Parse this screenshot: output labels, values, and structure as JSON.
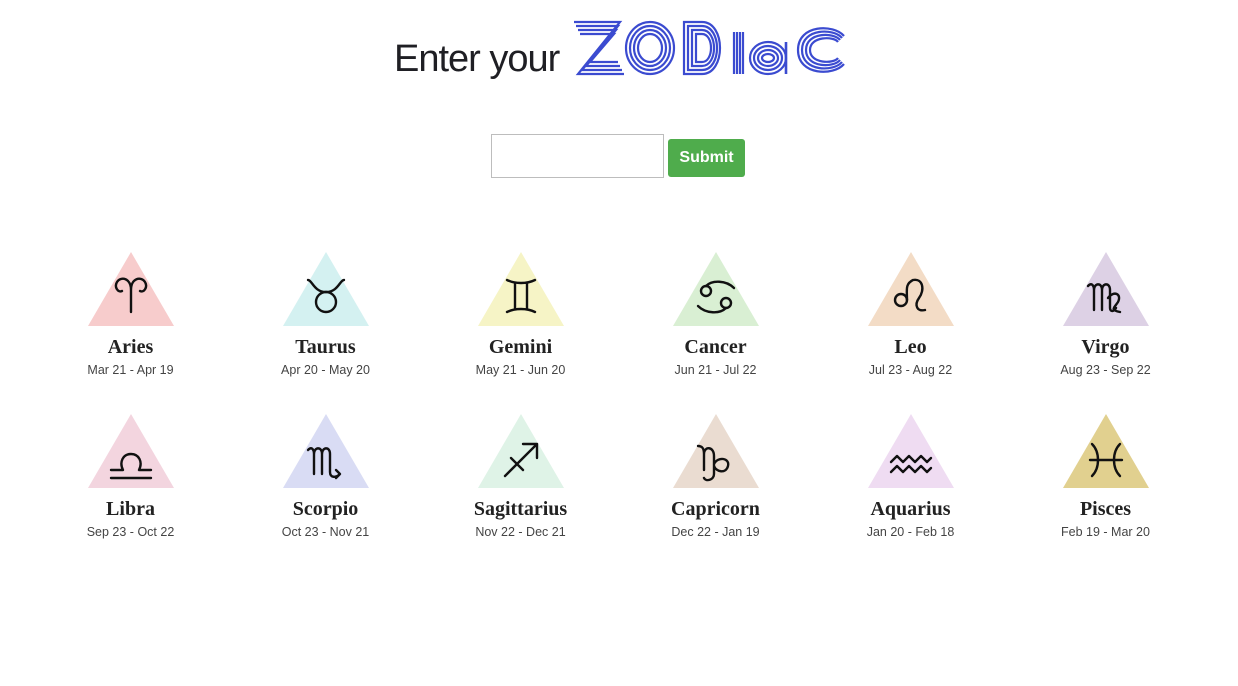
{
  "header": {
    "prefix": "Enter your",
    "logo_text": "ZODIAC",
    "logo_color": "#3b4bd0"
  },
  "search": {
    "input_value": "",
    "placeholder": "",
    "submit_label": "Submit",
    "submit_color": "#4fac4c"
  },
  "signs": [
    {
      "name": "Aries",
      "dates": "Mar 21 - Apr 19",
      "icon": "aries-icon",
      "color": "#f7cccc"
    },
    {
      "name": "Taurus",
      "dates": "Apr 20 - May 20",
      "icon": "taurus-icon",
      "color": "#d4f1f1"
    },
    {
      "name": "Gemini",
      "dates": "May 21 - Jun 20",
      "icon": "gemini-icon",
      "color": "#f6f4c6"
    },
    {
      "name": "Cancer",
      "dates": "Jun 21 - Jul 22",
      "icon": "cancer-icon",
      "color": "#d9efd3"
    },
    {
      "name": "Leo",
      "dates": "Jul 23 - Aug 22",
      "icon": "leo-icon",
      "color": "#f3dcc6"
    },
    {
      "name": "Virgo",
      "dates": "Aug 23 - Sep 22",
      "icon": "virgo-icon",
      "color": "#ddd1e5"
    },
    {
      "name": "Libra",
      "dates": "Sep 23 - Oct 22",
      "icon": "libra-icon",
      "color": "#f3d5df"
    },
    {
      "name": "Scorpio",
      "dates": "Oct 23 - Nov 21",
      "icon": "scorpio-icon",
      "color": "#d9dcf4"
    },
    {
      "name": "Sagittarius",
      "dates": "Nov 22 - Dec 21",
      "icon": "sagittarius-icon",
      "color": "#dff3e7"
    },
    {
      "name": "Capricorn",
      "dates": "Dec 22 - Jan 19",
      "icon": "capricorn-icon",
      "color": "#eadcd1"
    },
    {
      "name": "Aquarius",
      "dates": "Jan 20 - Feb 18",
      "icon": "aquarius-icon",
      "color": "#efdcf2"
    },
    {
      "name": "Pisces",
      "dates": "Feb 19 - Mar 20",
      "icon": "pisces-icon",
      "color": "#e1d08f"
    }
  ]
}
